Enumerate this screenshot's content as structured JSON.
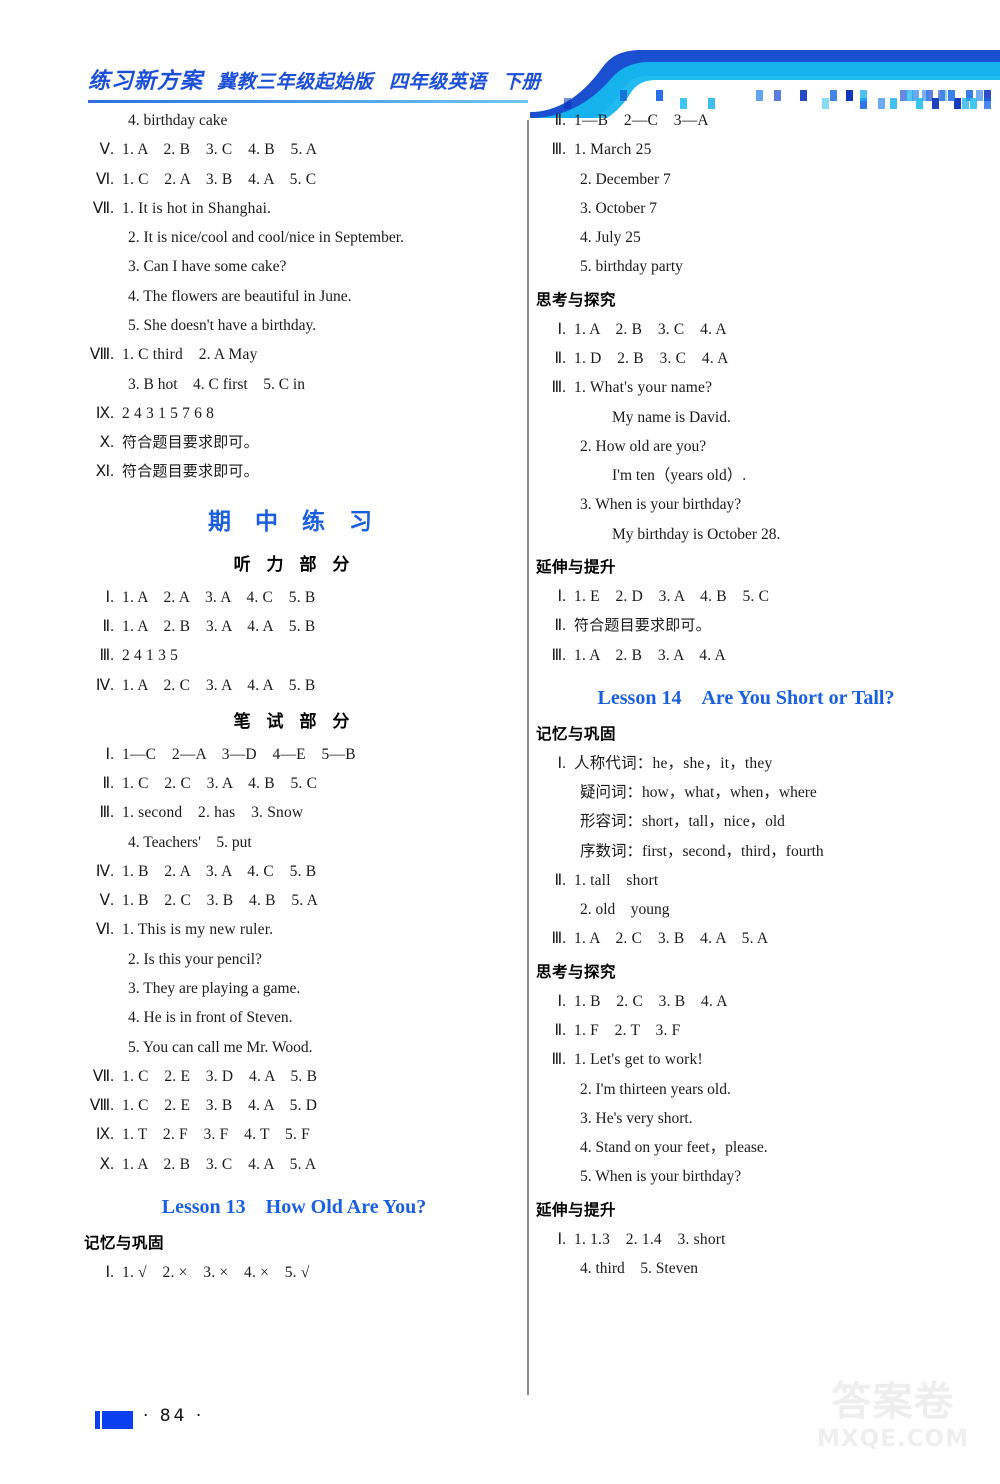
{
  "header": {
    "brand": "练习新方案",
    "edition": "冀教三年级起始版",
    "grade": "四年级英语",
    "volume": "下册",
    "accent_color": "#1b4fd8"
  },
  "footer": {
    "page_number": "· 84 ·",
    "watermark_cn": "答案卷",
    "watermark_en": "MXQE.COM"
  },
  "left_column": {
    "blocks": [
      {
        "type": "sub",
        "text": "4.  birthday cake"
      },
      {
        "type": "line",
        "rn": "Ⅴ.",
        "text": "1. A　2. B　3. C　4. B　5. A"
      },
      {
        "type": "line",
        "rn": "Ⅵ.",
        "text": "1. C　2. A　3. B　4. A　5. C"
      },
      {
        "type": "line",
        "rn": "Ⅶ.",
        "text": "1.  It is hot in Shanghai."
      },
      {
        "type": "sub",
        "text": "2.  It is nice/cool and cool/nice in September."
      },
      {
        "type": "sub",
        "text": "3.  Can I have some cake?"
      },
      {
        "type": "sub",
        "text": "4.  The flowers are beautiful in June."
      },
      {
        "type": "sub",
        "text": "5.  She doesn't have a birthday."
      },
      {
        "type": "line",
        "rn": "Ⅷ.",
        "text": "1.  C  third　2.  A  May"
      },
      {
        "type": "sub",
        "text": "3.  B  hot　4.  C  first　5.  C  in"
      },
      {
        "type": "line",
        "rn": "Ⅸ.",
        "text": "2  4  3  1  5  7  6  8"
      },
      {
        "type": "line",
        "rn": "Ⅹ.",
        "text": "符合题目要求即可。",
        "cn": true
      },
      {
        "type": "line",
        "rn": "Ⅺ.",
        "text": "符合题目要求即可。",
        "cn": true
      },
      {
        "type": "title_blue",
        "text": "期 中 练 习"
      },
      {
        "type": "title_black",
        "text": "听 力 部 分"
      },
      {
        "type": "line",
        "rn": "Ⅰ.",
        "text": "1. A　2. A　3. A　4. C　5. B"
      },
      {
        "type": "line",
        "rn": "Ⅱ.",
        "text": "1. A　2. B　3. A　4. A　5. B"
      },
      {
        "type": "line",
        "rn": "Ⅲ.",
        "text": "2  4  1  3  5"
      },
      {
        "type": "line",
        "rn": "Ⅳ.",
        "text": "1. A　2. C　3. A　4. A　5. B"
      },
      {
        "type": "title_black",
        "text": "笔 试 部 分"
      },
      {
        "type": "line",
        "rn": "Ⅰ.",
        "text": "1—C　2—A　3—D　4—E　5—B"
      },
      {
        "type": "line",
        "rn": "Ⅱ.",
        "text": "1. C　2. C　3. A　4. B　5. C"
      },
      {
        "type": "line",
        "rn": "Ⅲ.",
        "text": "1.  second　2.  has　3.  Snow"
      },
      {
        "type": "sub",
        "text": "4.  Teachers'　5.  put"
      },
      {
        "type": "line",
        "rn": "Ⅳ.",
        "text": "1. B　2. A　3. A　4. C　5. B"
      },
      {
        "type": "line",
        "rn": "Ⅴ.",
        "text": "1. B　2. C　3. B　4. B　5. A"
      },
      {
        "type": "line",
        "rn": "Ⅵ.",
        "text": "1.  This is my new ruler."
      },
      {
        "type": "sub",
        "text": "2.  Is this your pencil?"
      },
      {
        "type": "sub",
        "text": "3.  They are playing a game."
      },
      {
        "type": "sub",
        "text": "4.  He is in front of Steven."
      },
      {
        "type": "sub",
        "text": "5.  You can call me Mr. Wood."
      },
      {
        "type": "line",
        "rn": "Ⅶ.",
        "text": "1. C　2. E　3. D　4. A　5. B"
      },
      {
        "type": "line",
        "rn": "Ⅷ.",
        "text": "1. C　2. E　3. B　4. A　5. D"
      },
      {
        "type": "line",
        "rn": "Ⅸ.",
        "text": "1. T　2. F　3. F　4. T　5. F"
      },
      {
        "type": "line",
        "rn": "Ⅹ.",
        "text": "1. A　2. B　3. C　4. A　5. A"
      },
      {
        "type": "lesson",
        "number": "Lesson 13",
        "title": "How Old Are You?"
      },
      {
        "type": "heading_cn",
        "text": "记忆与巩固"
      },
      {
        "type": "line",
        "rn": "Ⅰ.",
        "text": "1.  √　2.  ×　3.  ×　4.  ×　5.  √"
      }
    ]
  },
  "right_column": {
    "blocks": [
      {
        "type": "line",
        "rn": "Ⅱ.",
        "text": "1—B　2—C　3—A"
      },
      {
        "type": "line",
        "rn": "Ⅲ.",
        "text": "1.  March 25"
      },
      {
        "type": "sub",
        "text": "2.  December 7"
      },
      {
        "type": "sub",
        "text": "3.  October 7"
      },
      {
        "type": "sub",
        "text": "4.  July 25"
      },
      {
        "type": "sub",
        "text": "5.  birthday party"
      },
      {
        "type": "heading_cn",
        "text": "思考与探究"
      },
      {
        "type": "line",
        "rn": "Ⅰ.",
        "text": "1. A　2. B　3. C　4. A"
      },
      {
        "type": "line",
        "rn": "Ⅱ.",
        "text": "1. D　2. B　3. C　4. A"
      },
      {
        "type": "line",
        "rn": "Ⅲ.",
        "text": "1.  What's your name?"
      },
      {
        "type": "sub2",
        "text": "My name is David."
      },
      {
        "type": "sub",
        "text": "2.  How old are you?"
      },
      {
        "type": "sub2",
        "text": "I'm ten（years old）."
      },
      {
        "type": "sub",
        "text": "3.  When is your birthday?"
      },
      {
        "type": "sub2",
        "text": "My birthday is October 28."
      },
      {
        "type": "heading_cn",
        "text": "延伸与提升"
      },
      {
        "type": "line",
        "rn": "Ⅰ.",
        "text": "1. E　2. D　3. A　4. B　5. C"
      },
      {
        "type": "line",
        "rn": "Ⅱ.",
        "text": "符合题目要求即可。",
        "cn": true
      },
      {
        "type": "line",
        "rn": "Ⅲ.",
        "text": "1. A　2. B　3. A　4. A"
      },
      {
        "type": "lesson",
        "number": "Lesson 14",
        "title": "Are You Short or Tall?"
      },
      {
        "type": "heading_cn",
        "text": "记忆与巩固"
      },
      {
        "type": "line",
        "rn": "Ⅰ.",
        "text": "人称代词：he，she，it，they"
      },
      {
        "type": "sub",
        "text": "疑问词：how，what，when，where"
      },
      {
        "type": "sub",
        "text": "形容词：short，tall，nice，old"
      },
      {
        "type": "sub",
        "text": "序数词：first，second，third，fourth"
      },
      {
        "type": "line",
        "rn": "Ⅱ.",
        "text": "1.  tall　short"
      },
      {
        "type": "sub",
        "text": "2.  old　young"
      },
      {
        "type": "line",
        "rn": "Ⅲ.",
        "text": "1. A　2. C　3. B　4. A　5. A"
      },
      {
        "type": "heading_cn",
        "text": "思考与探究"
      },
      {
        "type": "line",
        "rn": "Ⅰ.",
        "text": "1. B　2. C　3. B　4. A"
      },
      {
        "type": "line",
        "rn": "Ⅱ.",
        "text": "1. F　2. T　3. F"
      },
      {
        "type": "line",
        "rn": "Ⅲ.",
        "text": "1.  Let's get to work!"
      },
      {
        "type": "sub",
        "text": "2.  I'm thirteen years old."
      },
      {
        "type": "sub",
        "text": "3.  He's very short."
      },
      {
        "type": "sub",
        "text": "4.  Stand on your feet，please."
      },
      {
        "type": "sub",
        "text": "5.  When is your birthday?"
      },
      {
        "type": "heading_cn",
        "text": "延伸与提升"
      },
      {
        "type": "line",
        "rn": "Ⅰ.",
        "text": "1. 1.3　2. 1.4　3.  short"
      },
      {
        "type": "sub",
        "text": "4.  third　5.  Steven"
      }
    ]
  }
}
